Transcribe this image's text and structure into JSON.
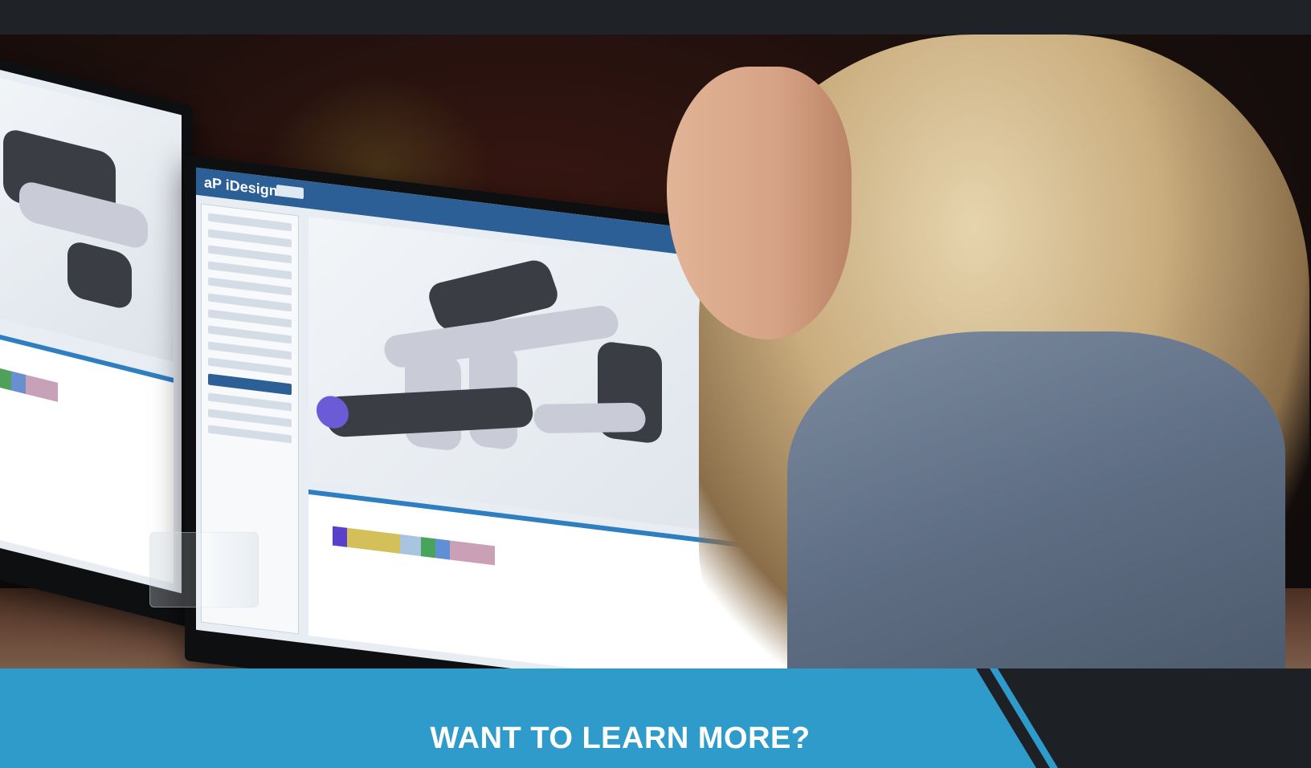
{
  "app_screen": {
    "logo": "aP iDesign"
  },
  "cta": {
    "title": "WANT TO LEARN MORE?"
  },
  "colors": {
    "cta_background": "#2e9bcb",
    "top_bar": "#1f2328",
    "app_header": "#2c5f95"
  }
}
